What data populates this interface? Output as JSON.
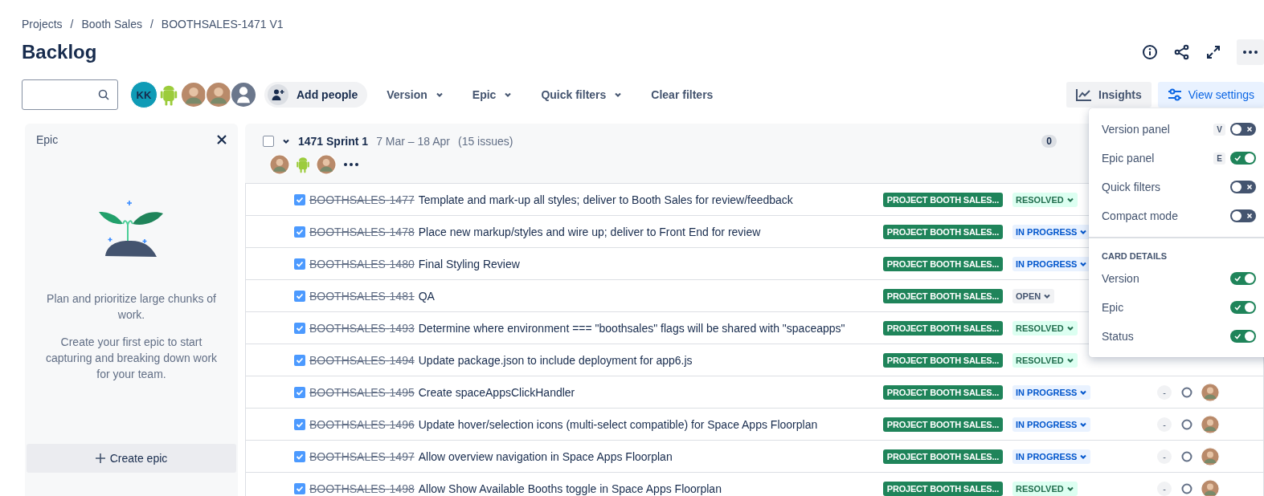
{
  "breadcrumbs": [
    "Projects",
    "Booth Sales",
    "BOOTHSALES-1471 V1"
  ],
  "breadcrumb_separator": "/",
  "title": "Backlog",
  "toolbar": {
    "avatars": [
      {
        "kind": "initials",
        "text": "KK"
      },
      {
        "kind": "robot"
      },
      {
        "kind": "photo"
      },
      {
        "kind": "photo"
      },
      {
        "kind": "default"
      }
    ],
    "add_people": "Add people",
    "filters": [
      {
        "label": "Version",
        "kind": "dropdown"
      },
      {
        "label": "Epic",
        "kind": "dropdown"
      },
      {
        "label": "Quick filters",
        "kind": "dropdown"
      },
      {
        "label": "Clear filters",
        "kind": "button"
      }
    ],
    "insights": "Insights",
    "view_settings": "View settings"
  },
  "epic_panel": {
    "title": "Epic",
    "texts": [
      "Plan and prioritize large chunks of work.",
      "Create your first epic to start capturing and breaking down work for your team."
    ],
    "create": "Create epic"
  },
  "sprint": {
    "name": "1471 Sprint 1",
    "dates": "7 Mar – 18 Apr",
    "count": "(15 issues)",
    "checked": false,
    "expanded": true,
    "badge": "0",
    "avatars": [
      {
        "kind": "photo"
      },
      {
        "kind": "robot"
      },
      {
        "kind": "photo"
      }
    ],
    "issues": [
      {
        "key": "BOOTHSALES-1477",
        "summary": "Template and mark-up all styles; deliver to Booth Sales for review/feedback",
        "done": true,
        "epic": "PROJECT BOOTH SALES...",
        "status": "RESOLVED",
        "kind": "done"
      },
      {
        "key": "BOOTHSALES-1478",
        "summary": "Place new markup/styles and wire up; deliver to Front End for review",
        "done": true,
        "epic": "PROJECT BOOTH SALES...",
        "status": "IN PROGRESS",
        "kind": "progress"
      },
      {
        "key": "BOOTHSALES-1480",
        "summary": "Final Styling Review",
        "done": true,
        "epic": "PROJECT BOOTH SALES...",
        "status": "IN PROGRESS",
        "kind": "progress"
      },
      {
        "key": "BOOTHSALES-1481",
        "summary": "QA",
        "done": true,
        "epic": "PROJECT BOOTH SALES...",
        "status": "OPEN",
        "kind": "todo"
      },
      {
        "key": "BOOTHSALES-1493",
        "summary": "Determine where environment === \"boothsales\" flags will be shared with \"spaceapps\"",
        "done": true,
        "epic": "PROJECT BOOTH SALES...",
        "status": "RESOLVED",
        "kind": "done"
      },
      {
        "key": "BOOTHSALES-1494",
        "summary": "Update package.json to include deployment for app6.js",
        "done": true,
        "epic": "PROJECT BOOTH SALES...",
        "status": "RESOLVED",
        "kind": "done"
      },
      {
        "key": "BOOTHSALES-1495",
        "summary": "Create spaceAppsClickHandler",
        "done": true,
        "epic": "PROJECT BOOTH SALES...",
        "status": "IN PROGRESS",
        "kind": "progress",
        "estimate": "-"
      },
      {
        "key": "BOOTHSALES-1496",
        "summary": "Update hover/selection icons (multi-select compatible) for Space Apps Floorplan",
        "done": true,
        "epic": "PROJECT BOOTH SALES...",
        "status": "IN PROGRESS",
        "kind": "progress",
        "estimate": "-"
      },
      {
        "key": "BOOTHSALES-1497",
        "summary": "Allow overview navigation in Space Apps Floorplan",
        "done": true,
        "epic": "PROJECT BOOTH SALES...",
        "status": "IN PROGRESS",
        "kind": "progress",
        "estimate": "-"
      },
      {
        "key": "BOOTHSALES-1498",
        "summary": "Allow Show Available Booths toggle in Space Apps Floorplan",
        "done": true,
        "epic": "PROJECT BOOTH SALES...",
        "status": "RESOLVED",
        "kind": "done",
        "estimate": "-"
      }
    ]
  },
  "view_menu": {
    "panels": [
      {
        "label": "Version panel",
        "shortcut": "V",
        "on": false
      },
      {
        "label": "Epic panel",
        "shortcut": "E",
        "on": true
      },
      {
        "label": "Quick filters",
        "on": false
      },
      {
        "label": "Compact mode",
        "on": false
      }
    ],
    "card_details_heading": "CARD DETAILS",
    "card_details": [
      {
        "label": "Version",
        "on": true
      },
      {
        "label": "Epic",
        "on": true
      },
      {
        "label": "Status",
        "on": true
      }
    ]
  }
}
